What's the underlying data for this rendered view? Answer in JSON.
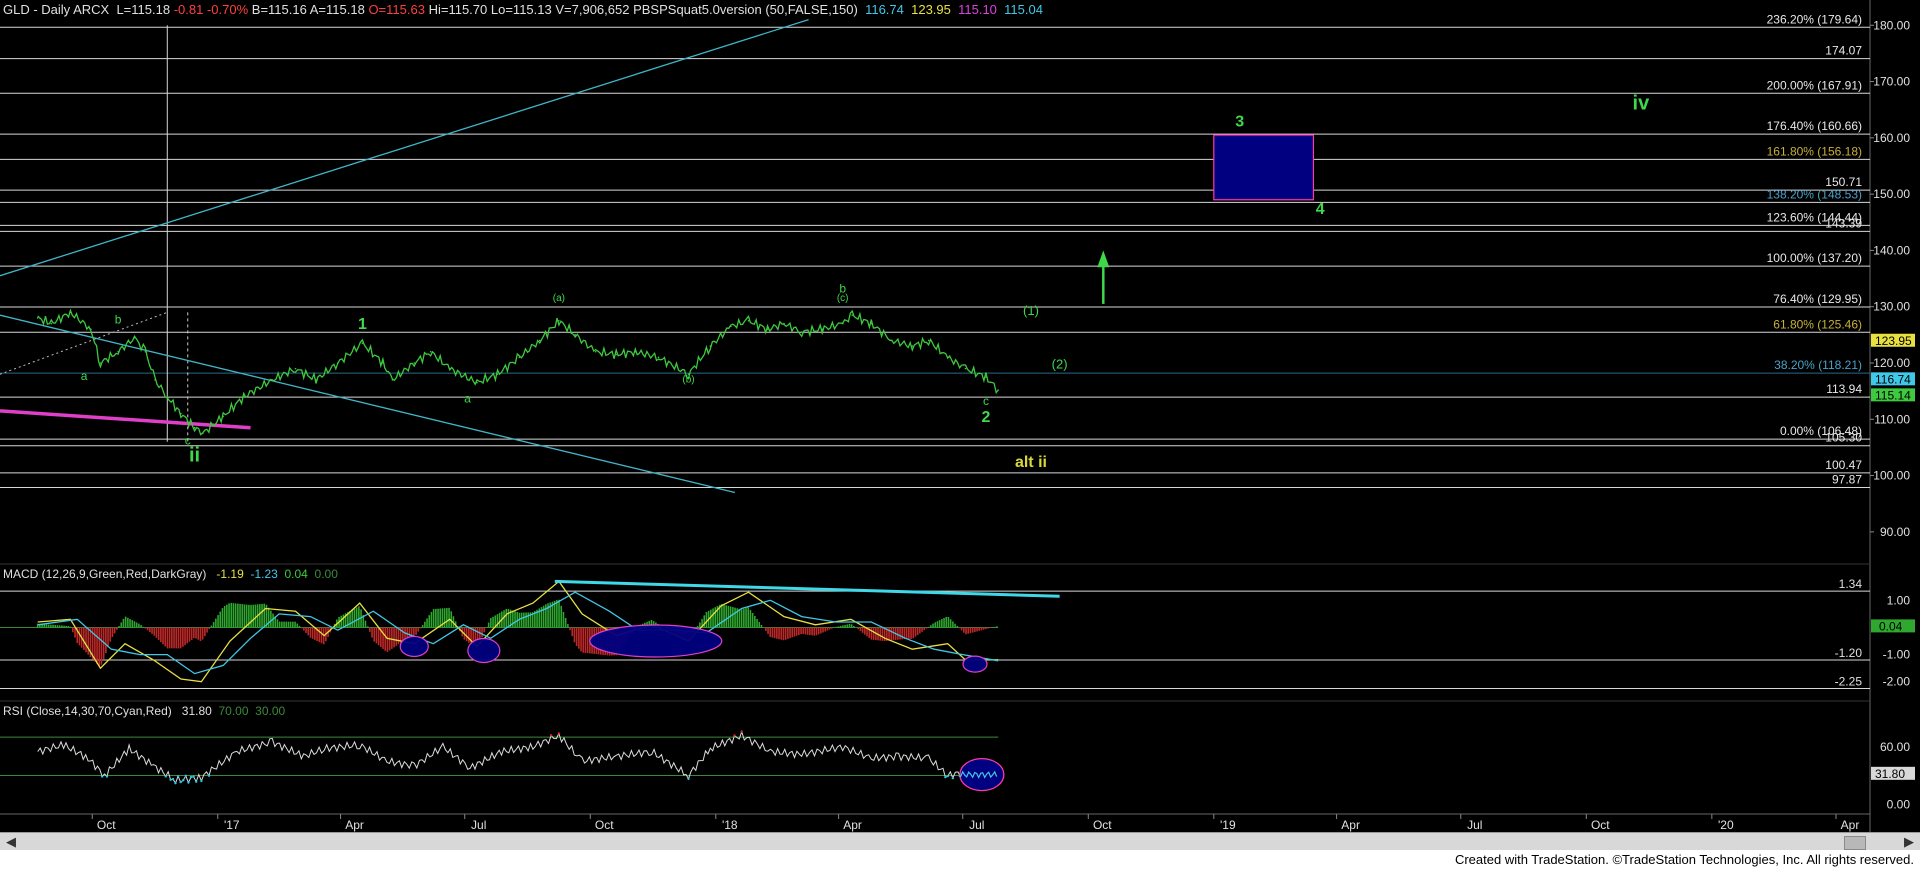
{
  "header": {
    "symbol": "GLD - Daily  ARCX",
    "last": "L=115.18",
    "change": "-0.81",
    "change_pct": "-0.70%",
    "bid": "B=115.16",
    "ask": "A=115.18",
    "open": "O=115.63",
    "high": "Hi=115.70",
    "low": "Lo=115.13",
    "volume": "V=7,906,652",
    "study": "PBSPSquat5.0version (50,FALSE,150)",
    "study_values": [
      "116.74",
      "123.95",
      "115.10",
      "115.04"
    ]
  },
  "colors": {
    "background": "#000000",
    "price": "#3ec93e",
    "fib_line": "#ffffff",
    "trendline": "#40b4c8",
    "magenta": "#e040c8",
    "macd_cyan": "#3fd8e8",
    "target_box": "#000080",
    "box_border": "#ff3aa0",
    "wave_green": "#3fd84a",
    "alt_yellow": "#d8d838",
    "fib_gold": "#c8b038",
    "fib_teal": "#4aa0c8"
  },
  "chart_data": [
    {
      "type": "line",
      "panel": "price",
      "title": "GLD - Daily ARCX",
      "ylim": [
        85,
        182
      ],
      "y_ticks": [
        "90.00",
        "100.00",
        "110.00",
        "120.00",
        "130.00",
        "140.00",
        "150.00",
        "160.00",
        "170.00",
        "180.00"
      ],
      "x_ticks": [
        "Oct",
        "'17",
        "Apr",
        "Jul",
        "Oct",
        "'18",
        "Apr",
        "Jul",
        "Oct",
        "'19",
        "Apr",
        "Jul",
        "Oct",
        "'20",
        "Apr"
      ],
      "series": [
        {
          "x": [
            "2016-08-22",
            "2016-09-01",
            "2016-09-15",
            "2016-09-30",
            "2016-10-07",
            "2016-10-20",
            "2016-11-01",
            "2016-11-09",
            "2016-11-16",
            "2016-11-25",
            "2016-12-05",
            "2016-12-15",
            "2016-12-21",
            "2017-01-05",
            "2017-01-20",
            "2017-02-10",
            "2017-02-27",
            "2017-03-14",
            "2017-03-30",
            "2017-04-17",
            "2017-05-02",
            "2017-05-09",
            "2017-05-25",
            "2017-06-06",
            "2017-06-20",
            "2017-07-10",
            "2017-07-25",
            "2017-08-10",
            "2017-08-25",
            "2017-09-08",
            "2017-09-20",
            "2017-10-05",
            "2017-10-20",
            "2017-11-03",
            "2017-11-20",
            "2017-12-12",
            "2017-12-28",
            "2018-01-12",
            "2018-01-25",
            "2018-02-08",
            "2018-02-20",
            "2018-03-05",
            "2018-03-20",
            "2018-04-04",
            "2018-04-11",
            "2018-04-25",
            "2018-05-10",
            "2018-05-25",
            "2018-06-06",
            "2018-06-20",
            "2018-07-03",
            "2018-07-18",
            "2018-07-27"
          ],
          "values": [
            128,
            127,
            129,
            126,
            120,
            122,
            124.5,
            122,
            117,
            114,
            111,
            108.5,
            107.5,
            110.5,
            114,
            117,
            119,
            117,
            120,
            123.5,
            120,
            117,
            120,
            122,
            119,
            116.5,
            118,
            121,
            124,
            127.5,
            125,
            122,
            121.5,
            122,
            121,
            118,
            123,
            126.5,
            127.5,
            126,
            127,
            125.5,
            126,
            127,
            128.5,
            127,
            124,
            123,
            124,
            121,
            119,
            117.5,
            115.2
          ]
        }
      ],
      "fib_levels": [
        {
          "label": "236.20% (179.64)",
          "value": 179.64
        },
        {
          "label": "174.07",
          "value": 174.07
        },
        {
          "label": "200.00% (167.91)",
          "value": 167.91
        },
        {
          "label": "176.40% (160.66)",
          "value": 160.66
        },
        {
          "label": "161.80% (156.18)",
          "value": 156.18
        },
        {
          "label": "150.71",
          "value": 150.71
        },
        {
          "label": "138.20% (148.53)",
          "value": 148.53
        },
        {
          "label": "123.60% (144.44)",
          "value": 144.44
        },
        {
          "label": "143.39",
          "value": 143.39
        },
        {
          "label": "100.00% (137.20)",
          "value": 137.2
        },
        {
          "label": "76.40% (129.95)",
          "value": 129.95
        },
        {
          "label": "61.80% (125.46)",
          "value": 125.46
        },
        {
          "label": "38.20% (118.21)",
          "value": 118.21
        },
        {
          "label": "113.94",
          "value": 113.94
        },
        {
          "label": "0.00% (106.48)",
          "value": 106.48
        },
        {
          "label": "105.30",
          "value": 105.3
        },
        {
          "label": "100.47",
          "value": 100.47
        },
        {
          "label": "97.87",
          "value": 97.87
        }
      ],
      "price_tags": [
        "123.95",
        "116.74",
        "115.14"
      ],
      "target_box": {
        "from": "2019-01-01",
        "to": "2019-03-15",
        "y_low": 149,
        "y_high": 160.5
      },
      "annotations": [
        {
          "text": "ii",
          "date": "2016-12-15",
          "value": 102.5,
          "role": "wave-green-large"
        },
        {
          "text": "a",
          "date": "2016-09-25",
          "value": 117,
          "role": "wave-small"
        },
        {
          "text": "b",
          "date": "2016-10-20",
          "value": 127,
          "role": "wave-small"
        },
        {
          "text": "c",
          "date": "2016-12-10",
          "value": 105.5,
          "role": "wave-small"
        },
        {
          "text": "1",
          "date": "2017-04-17",
          "value": 126,
          "role": "wave-green-medium"
        },
        {
          "text": "a",
          "date": "2017-07-03",
          "value": 113,
          "role": "wave-small"
        },
        {
          "text": "(a)",
          "date": "2017-09-08",
          "value": 131,
          "role": "wave-tiny"
        },
        {
          "text": "(b)",
          "date": "2017-12-12",
          "value": 116.5,
          "role": "wave-tiny"
        },
        {
          "text": "(c)",
          "date": "2018-04-04",
          "value": 131,
          "role": "wave-tiny"
        },
        {
          "text": "b",
          "date": "2018-04-04",
          "value": 132.5,
          "role": "wave-small"
        },
        {
          "text": "c",
          "date": "2018-07-18",
          "value": 112.5,
          "role": "wave-small"
        },
        {
          "text": "2",
          "date": "2018-07-18",
          "value": 109.5,
          "role": "wave-green-medium"
        },
        {
          "text": "alt ii",
          "date": "2018-08-20",
          "value": 101.5,
          "role": "wave-yellow"
        },
        {
          "text": "(1)",
          "date": "2018-08-20",
          "value": 128.5,
          "role": "wave-green-small"
        },
        {
          "text": "(2)",
          "date": "2018-09-10",
          "value": 119,
          "role": "wave-green-small"
        },
        {
          "text": "3",
          "date": "2019-01-20",
          "value": 162,
          "role": "wave-green-medium"
        },
        {
          "text": "4",
          "date": "2019-03-20",
          "value": 146.5,
          "role": "wave-green-medium"
        },
        {
          "text": "iv",
          "date": "2019-11-10",
          "value": 165,
          "role": "wave-green-large"
        }
      ]
    },
    {
      "type": "line",
      "panel": "macd",
      "title": "MACD (12,26,9,Green,Red,DarkGray)",
      "values_shown": [
        "-1.19",
        "-1.23",
        "0.04",
        "0.00"
      ],
      "ylim": [
        -2.6,
        1.75
      ],
      "y_ticks": [
        "1.00",
        "0.00",
        "-1.00",
        "-2.00"
      ],
      "levels": [
        {
          "label": "1.34",
          "value": 1.34
        },
        {
          "label": "-1.20",
          "value": -1.2
        },
        {
          "label": "-2.25",
          "value": -2.25
        }
      ],
      "current_tag": "0.04",
      "series": [
        {
          "name": "MACD",
          "x": [
            "2016-08-22",
            "2016-09-15",
            "2016-10-07",
            "2016-10-25",
            "2016-11-15",
            "2016-12-05",
            "2016-12-20",
            "2017-01-10",
            "2017-02-05",
            "2017-02-27",
            "2017-03-20",
            "2017-04-15",
            "2017-05-05",
            "2017-05-25",
            "2017-06-20",
            "2017-07-10",
            "2017-08-01",
            "2017-08-20",
            "2017-09-08",
            "2017-09-25",
            "2017-10-20",
            "2017-11-15",
            "2017-12-12",
            "2018-01-05",
            "2018-01-25",
            "2018-02-20",
            "2018-03-15",
            "2018-04-10",
            "2018-05-05",
            "2018-05-25",
            "2018-06-20",
            "2018-07-03",
            "2018-07-27"
          ],
          "values": [
            0.2,
            0.3,
            -1.5,
            -0.6,
            -1.2,
            -1.9,
            -2.0,
            -0.5,
            0.7,
            0.6,
            -0.3,
            0.9,
            -0.4,
            -0.6,
            0.3,
            -0.7,
            0.5,
            0.9,
            1.7,
            0.5,
            -0.3,
            0.1,
            -0.5,
            0.8,
            1.3,
            0.4,
            0.1,
            0.3,
            -0.4,
            -0.8,
            -0.6,
            -1.2,
            -1.19
          ]
        },
        {
          "name": "Signal",
          "x": [
            "2016-08-22",
            "2016-09-20",
            "2016-10-15",
            "2016-11-05",
            "2016-11-25",
            "2016-12-15",
            "2017-01-05",
            "2017-01-25",
            "2017-02-15",
            "2017-03-10",
            "2017-03-30",
            "2017-04-25",
            "2017-05-18",
            "2017-06-08",
            "2017-06-30",
            "2017-07-20",
            "2017-08-10",
            "2017-08-30",
            "2017-09-20",
            "2017-10-15",
            "2017-11-05",
            "2017-12-01",
            "2017-12-25",
            "2018-01-20",
            "2018-02-10",
            "2018-03-05",
            "2018-03-30",
            "2018-04-25",
            "2018-05-20",
            "2018-06-10",
            "2018-07-01",
            "2018-07-27"
          ],
          "values": [
            0.1,
            0.3,
            -0.8,
            -1.0,
            -1.0,
            -1.7,
            -1.4,
            -0.4,
            0.5,
            0.4,
            -0.1,
            0.6,
            -0.2,
            -0.6,
            0.1,
            -0.4,
            0.3,
            0.7,
            1.3,
            0.6,
            -0.1,
            -0.1,
            -0.2,
            0.7,
            1.0,
            0.4,
            0.2,
            0.2,
            -0.4,
            -0.8,
            -1.0,
            -1.23
          ]
        }
      ],
      "trendline": {
        "from": [
          "2017-09-05",
          1.7
        ],
        "to": [
          "2018-09-10",
          1.15
        ]
      }
    },
    {
      "type": "line",
      "panel": "rsi",
      "title": "RSI (Close,14,30,70,Cyan,Red)",
      "values_shown": [
        "31.80",
        "70.00",
        "30.00"
      ],
      "ylim": [
        -8,
        90
      ],
      "y_ticks": [
        "60.00",
        "0.00"
      ],
      "levels": [
        70,
        30
      ],
      "current_tag": "31.80",
      "series": [
        {
          "name": "RSI",
          "x": [
            "2016-08-22",
            "2016-09-10",
            "2016-09-28",
            "2016-10-10",
            "2016-10-28",
            "2016-11-15",
            "2016-12-01",
            "2016-12-20",
            "2017-01-15",
            "2017-02-10",
            "2017-03-05",
            "2017-03-20",
            "2017-04-15",
            "2017-05-05",
            "2017-05-25",
            "2017-06-15",
            "2017-07-05",
            "2017-07-28",
            "2017-08-20",
            "2017-09-08",
            "2017-09-25",
            "2017-10-20",
            "2017-11-15",
            "2017-12-12",
            "2017-12-28",
            "2018-01-20",
            "2018-02-10",
            "2018-03-05",
            "2018-04-04",
            "2018-04-25",
            "2018-05-15",
            "2018-06-06",
            "2018-06-20",
            "2018-07-03",
            "2018-07-18",
            "2018-07-27"
          ],
          "values": [
            55,
            62,
            48,
            30,
            58,
            40,
            25,
            28,
            55,
            65,
            50,
            58,
            62,
            45,
            40,
            60,
            38,
            55,
            60,
            72,
            45,
            50,
            55,
            30,
            58,
            72,
            55,
            52,
            60,
            48,
            50,
            48,
            30,
            34,
            29,
            31.8
          ]
        }
      ]
    }
  ],
  "footer": {
    "credit": "Created with TradeStation. ©TradeStation Technologies, Inc. All rights reserved."
  }
}
